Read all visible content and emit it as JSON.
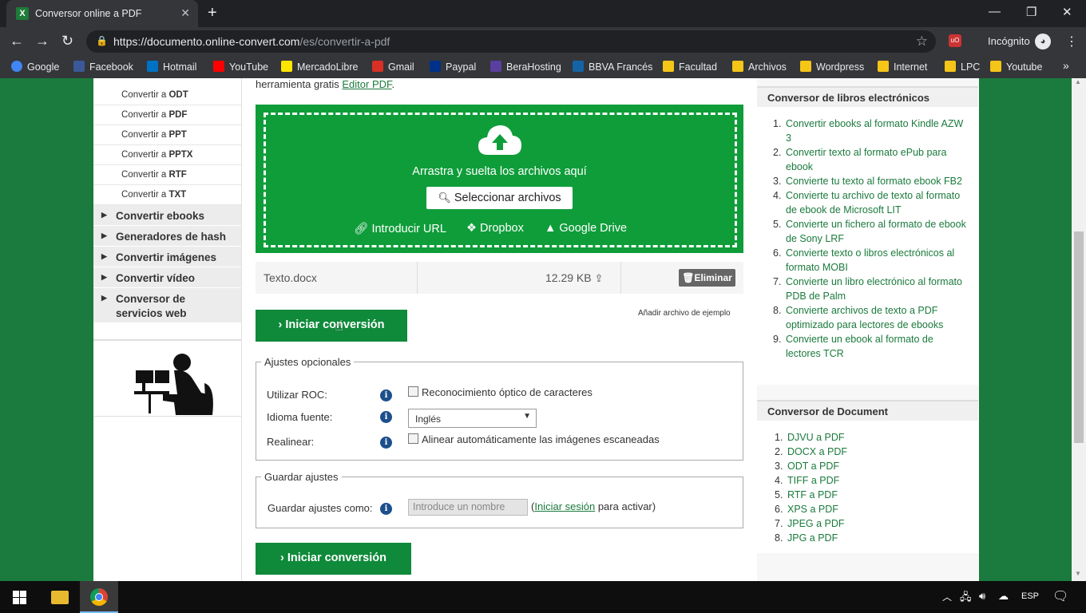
{
  "browser": {
    "tab_title": "Conversor online a PDF",
    "tab_close": "✕",
    "new_tab": "+",
    "url_host": "https://documento.online-convert.com",
    "url_path": "/es/convertir-a-pdf",
    "incognito_label": "Incógnito",
    "bookmarks": [
      {
        "label": "Google",
        "color": "#4285f4"
      },
      {
        "label": "Facebook",
        "color": "#3b5998"
      },
      {
        "label": "Hotmail",
        "color": "#0072c6"
      },
      {
        "label": "YouTube",
        "color": "#ff0000"
      },
      {
        "label": "MercadoLibre",
        "color": "#ffe600"
      },
      {
        "label": "Gmail",
        "color": "#d93025"
      },
      {
        "label": "Paypal",
        "color": "#003087"
      },
      {
        "label": "BeraHosting",
        "color": "#5a3fa0"
      },
      {
        "label": "BBVA Francés",
        "color": "#1464a5"
      },
      {
        "label": "Facultad",
        "color": "#f5c518"
      },
      {
        "label": "Archivos",
        "color": "#f5c518"
      },
      {
        "label": "Wordpress",
        "color": "#f5c518"
      },
      {
        "label": "Internet",
        "color": "#f5c518"
      },
      {
        "label": "LPC",
        "color": "#f5c518"
      },
      {
        "label": "Youtube",
        "color": "#f5c518"
      }
    ],
    "bookmarks_more": "»"
  },
  "sidebar": {
    "sub_items": [
      {
        "prefix": "Convertir a ",
        "fmt": "ODT"
      },
      {
        "prefix": "Convertir a ",
        "fmt": "PDF"
      },
      {
        "prefix": "Convertir a ",
        "fmt": "PPT"
      },
      {
        "prefix": "Convertir a ",
        "fmt": "PPTX"
      },
      {
        "prefix": "Convertir a ",
        "fmt": "RTF"
      },
      {
        "prefix": "Convertir a ",
        "fmt": "TXT"
      }
    ],
    "categories": [
      "Convertir ebooks",
      "Generadores de hash",
      "Convertir imágenes",
      "Convertir vídeo",
      "Conversor de servicios web"
    ]
  },
  "main": {
    "top_text": "herramienta gratis ",
    "top_link": "Editor PDF",
    "top_text_end": ".",
    "drop_text": "Arrastra y suelta los archivos aquí",
    "select_button": "Seleccionar archivos",
    "sources": [
      "Introducir URL",
      "Dropbox",
      "Google Drive"
    ],
    "file": {
      "name": "Texto.docx",
      "size": "12.29 KB",
      "delete_label": "Eliminar"
    },
    "start_label": "Iniciar conversión",
    "sample_link": "Añadir archivo de ejemplo",
    "optional": {
      "legend": "Ajustes opcionales",
      "ocr_label": "Utilizar ROC:",
      "ocr_check": "Reconocimiento óptico de caracteres",
      "lang_label": "Idioma fuente:",
      "lang_value": "Inglés",
      "realign_label": "Realinear:",
      "realign_check": "Alinear automáticamente las imágenes escaneadas"
    },
    "save": {
      "legend": "Guardar ajustes",
      "label": "Guardar ajustes como:",
      "placeholder": "Introduce un nombre",
      "paren_open": "(",
      "login_link": "Iniciar sesión",
      "after": " para activar)"
    }
  },
  "right": {
    "ebooks": {
      "title": "Conversor de libros electrónicos",
      "items": [
        "Convertir ebooks al formato Kindle AZW 3",
        "Convertir texto al formato ePub para ebook",
        "Convierte tu texto al formato ebook FB2",
        "Convierte tu archivo de texto al formato de ebook de Microsoft LIT",
        "Convierte un fichero al formato de ebook de Sony LRF",
        "Convierte texto o libros electrónicos al formato MOBI",
        "Convierte un libro electrónico al formato PDB de Palm",
        "Convierte archivos de texto a PDF optimizado para lectores de ebooks",
        "Convierte un ebook al formato de lectores TCR"
      ]
    },
    "document": {
      "title": "Conversor de Document",
      "items": [
        "DJVU a PDF",
        "DOCX a PDF",
        "ODT a PDF",
        "TIFF a PDF",
        "RTF a PDF",
        "XPS a PDF",
        "JPEG a PDF",
        "JPG a PDF"
      ]
    }
  },
  "taskbar": {
    "lang": "ESP"
  },
  "colors": {
    "brand_green": "#0f9d3a",
    "button_green": "#0f8a3a",
    "link_green": "#1b7a3d"
  }
}
